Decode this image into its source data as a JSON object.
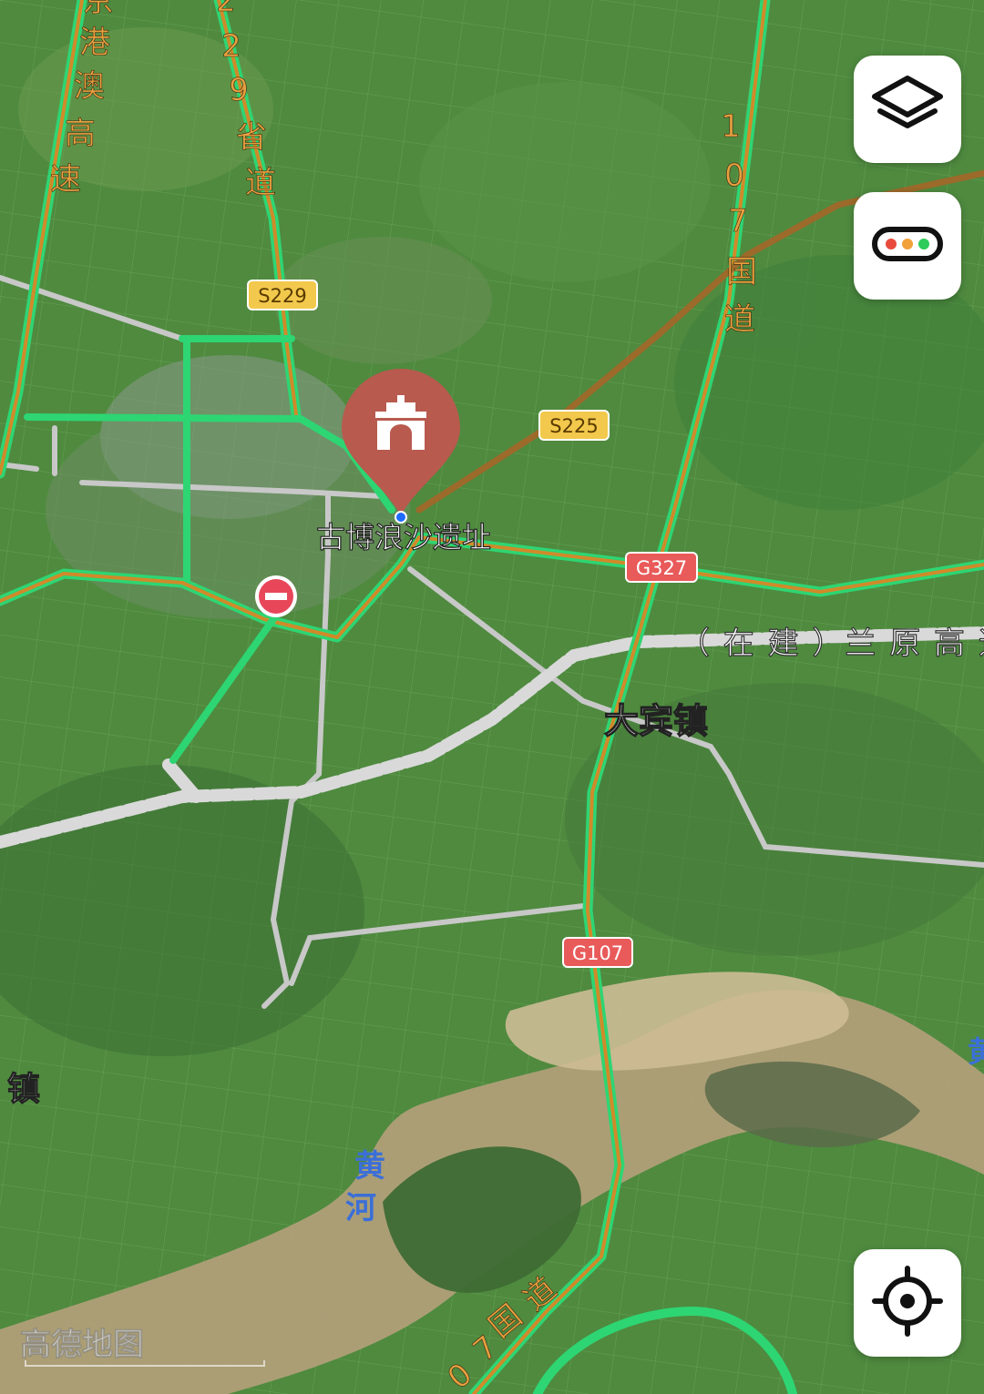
{
  "map": {
    "poi": {
      "name": "古博浪沙遗址"
    },
    "town": "大宾镇",
    "town_edge_left": "镇",
    "river": [
      "黄",
      "河"
    ],
    "river_edge_right": "黄",
    "road_labels": {
      "expressway_left": [
        "京",
        "港",
        "澳",
        "高",
        "速"
      ],
      "provincial_229": [
        "2",
        "2",
        "9",
        "省",
        "道"
      ],
      "national_107_north": [
        "1",
        "0",
        "7",
        "国",
        "道"
      ],
      "national_107_south": [
        "0",
        "7",
        "国",
        "道"
      ],
      "lanyuan_expressway": "（ 在 建 ）兰 原 高 速"
    },
    "shields": {
      "s229": "S229",
      "s225": "S225",
      "g327": "G327",
      "g107": "G107"
    },
    "watermark": "高德地图"
  },
  "controls": {
    "layers_icon": "layers-icon",
    "traffic_icon": "traffic-light-icon",
    "locate_icon": "locate-icon"
  },
  "colors": {
    "road_green": "#2ed573",
    "road_orange": "#d08a2a",
    "highway_brown": "#9c6a2a",
    "poi_marker": "#b85a4e",
    "shield_provincial": "#f2c94c",
    "shield_national": "#e95a5a",
    "river": "#b3a07a"
  }
}
